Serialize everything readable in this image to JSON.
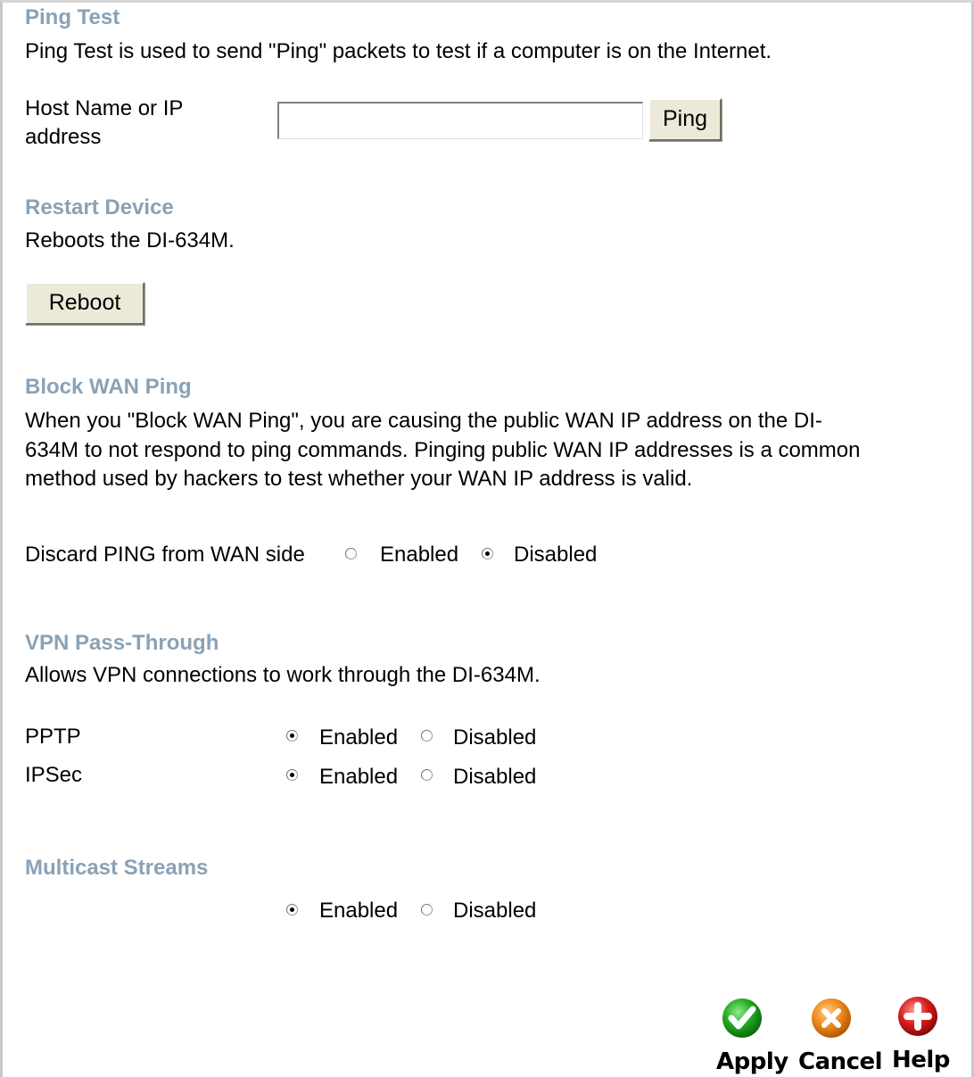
{
  "ping_test": {
    "heading": "Ping Test",
    "description": "Ping Test is used to send \"Ping\" packets to test if a computer is on the Internet.",
    "host_label_line1": "Host Name or IP",
    "host_label_line2": "address",
    "host_value": "",
    "ping_button": "Ping"
  },
  "restart_device": {
    "heading": "Restart Device",
    "description": "Reboots the DI-634M.",
    "reboot_button": "Reboot"
  },
  "block_wan_ping": {
    "heading": "Block WAN Ping",
    "description_line1": "When you \"Block WAN Ping\", you are causing the public WAN IP address on the DI-",
    "description_line2": "634M to not respond to ping commands. Pinging public WAN IP addresses is a common",
    "description_line3": "method used by hackers to test whether your WAN IP address is valid.",
    "discard_label": "Discard PING from WAN side",
    "enabled_label": "Enabled",
    "disabled_label": "Disabled",
    "selected": "Disabled"
  },
  "vpn_pass_through": {
    "heading": "VPN Pass-Through",
    "description": "Allows VPN connections to work through the DI-634M.",
    "rows": [
      {
        "label": "PPTP",
        "enabled_label": "Enabled",
        "disabled_label": "Disabled",
        "selected": "Enabled"
      },
      {
        "label": "IPSec",
        "enabled_label": "Enabled",
        "disabled_label": "Disabled",
        "selected": "Enabled"
      }
    ]
  },
  "multicast_streams": {
    "heading": "Multicast Streams",
    "enabled_label": "Enabled",
    "disabled_label": "Disabled",
    "selected": "Enabled"
  },
  "actions": {
    "apply": {
      "label": "Apply",
      "icon": "check-icon",
      "color": "#22aa22"
    },
    "cancel": {
      "label": "Cancel",
      "icon": "x-icon",
      "color": "#f08a1c"
    },
    "help": {
      "label": "Help",
      "icon": "plus-icon",
      "color": "#d81e1e"
    }
  },
  "colors": {
    "heading": "#8aa2b6",
    "button_face": "#ece9d8"
  }
}
